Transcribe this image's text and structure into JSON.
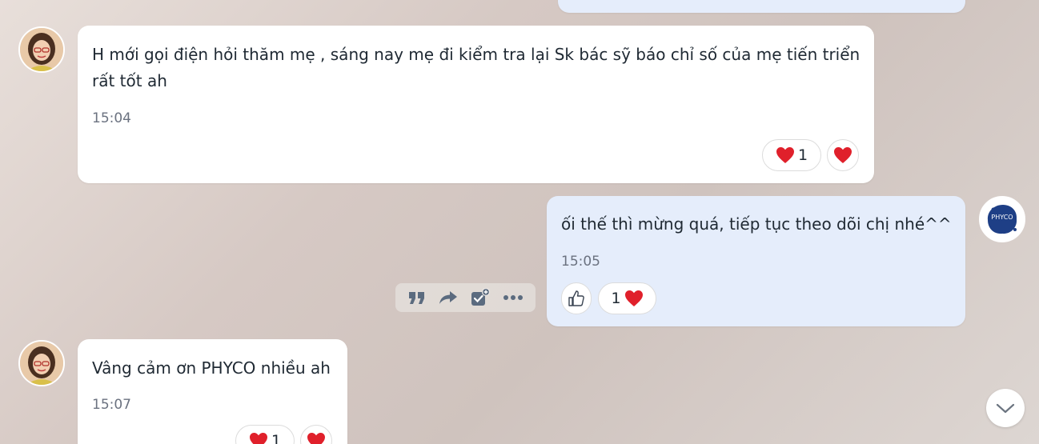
{
  "messages": [
    {
      "direction": "incoming",
      "text": "H mới gọi điện hỏi thăm mẹ , sáng nay mẹ đi kiểm tra lại Sk bác sỹ báo chỉ số của mẹ tiến triển\nrất tốt ah",
      "time": "15:04",
      "reaction_count": "1"
    },
    {
      "direction": "outgoing",
      "text": "ối thế thì mừng quá, tiếp tục theo dõi chị nhé^^",
      "time": "15:05",
      "reaction_count": "1"
    },
    {
      "direction": "incoming",
      "text": "Vâng cảm ơn PHYCO nhiều ah",
      "time": "15:07",
      "reaction_count": "1"
    }
  ],
  "own_avatar_text": "PHYCO",
  "toolbar": {
    "icons": [
      "quote-icon",
      "forward-icon",
      "add-task-icon",
      "more-icon"
    ]
  },
  "colors": {
    "incoming_bubble": "#ffffff",
    "outgoing_bubble": "#e5edfb",
    "heart": "#e0202b",
    "icon_gray": "#5b6b7f"
  }
}
